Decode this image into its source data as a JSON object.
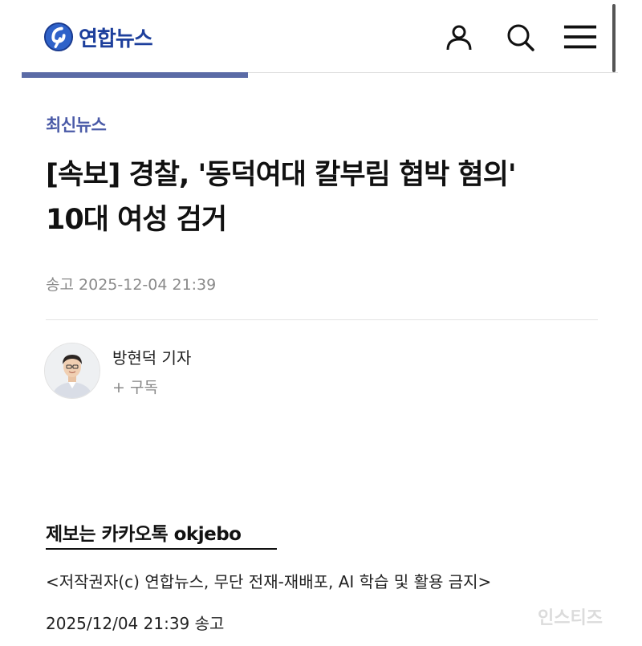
{
  "header": {
    "logo_text": "연합뉴스",
    "icons": [
      "user-icon",
      "search-icon",
      "menu-icon"
    ],
    "brand_color": "#1d3f9c"
  },
  "reading_progress": 0.38,
  "article": {
    "category": "최신뉴스",
    "title_line1": "[속보] 경찰, '동덕여대 칼부림 협박 혐의'",
    "title_line2": "10대 여성 검거",
    "sent_label": "송고",
    "sent_time": "2025-12-04 21:39",
    "reporter_name": "방현덕 기자",
    "subscribe_label": "+ 구독",
    "tip_text": "제보는 카카오톡 okjebo",
    "copyright": "<저작권자(c) 연합뉴스, 무단 전재-재배포, AI 학습 및 활용 금지>",
    "footer_datetime": "2025/12/04 21:39 송고"
  },
  "colors": {
    "accent": "#4a5aa7",
    "progress": "#5b6ba6"
  },
  "watermark": "인스티즈"
}
